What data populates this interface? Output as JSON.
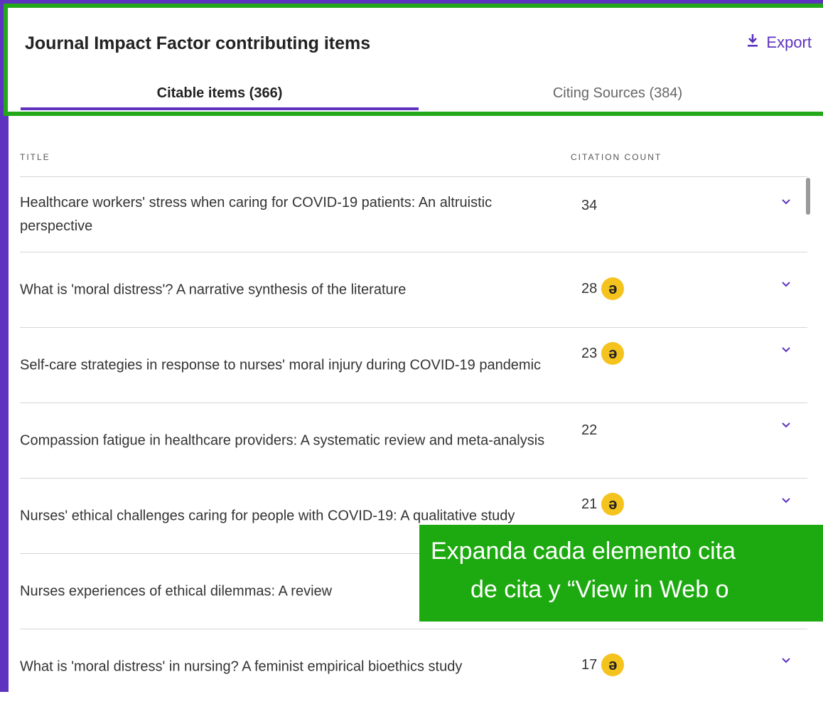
{
  "header": {
    "title": "Journal Impact Factor contributing items",
    "export_label": "Export",
    "export_icon": "download-icon"
  },
  "tabs": [
    {
      "label": "Citable items (366)",
      "active": true
    },
    {
      "label": "Citing Sources (384)",
      "active": false
    }
  ],
  "columns": {
    "title": "TITLE",
    "count": "CITATION COUNT"
  },
  "rows": [
    {
      "title": "Healthcare workers' stress when caring for COVID-19 patients: An altruistic perspective",
      "count": "34",
      "open_access": false
    },
    {
      "title": "What is 'moral distress'? A narrative synthesis of the literature",
      "count": "28",
      "open_access": true
    },
    {
      "title": "Self-care strategies in response to nurses' moral injury during COVID-19 pandemic",
      "count": "23",
      "open_access": true
    },
    {
      "title": "Compassion fatigue in healthcare providers: A systematic review and meta-analysis",
      "count": "22",
      "open_access": false
    },
    {
      "title": "Nurses' ethical challenges caring for people with COVID-19: A qualitative study",
      "count": "21",
      "open_access": true
    },
    {
      "title": "Nurses experiences of ethical dilemmas: A review",
      "count": "",
      "open_access": false
    },
    {
      "title": "What is 'moral distress' in nursing? A feminist empirical bioethics study",
      "count": "17",
      "open_access": true
    }
  ],
  "open_access_glyph": "ə",
  "banner": {
    "line1": "Expanda cada elemento cita",
    "line2": "de cita y “View in Web o"
  },
  "colors": {
    "accent": "#5e33bf",
    "highlight_border": "#22a818",
    "banner_bg": "#1daa10",
    "open_access_badge": "#f5c31e"
  }
}
